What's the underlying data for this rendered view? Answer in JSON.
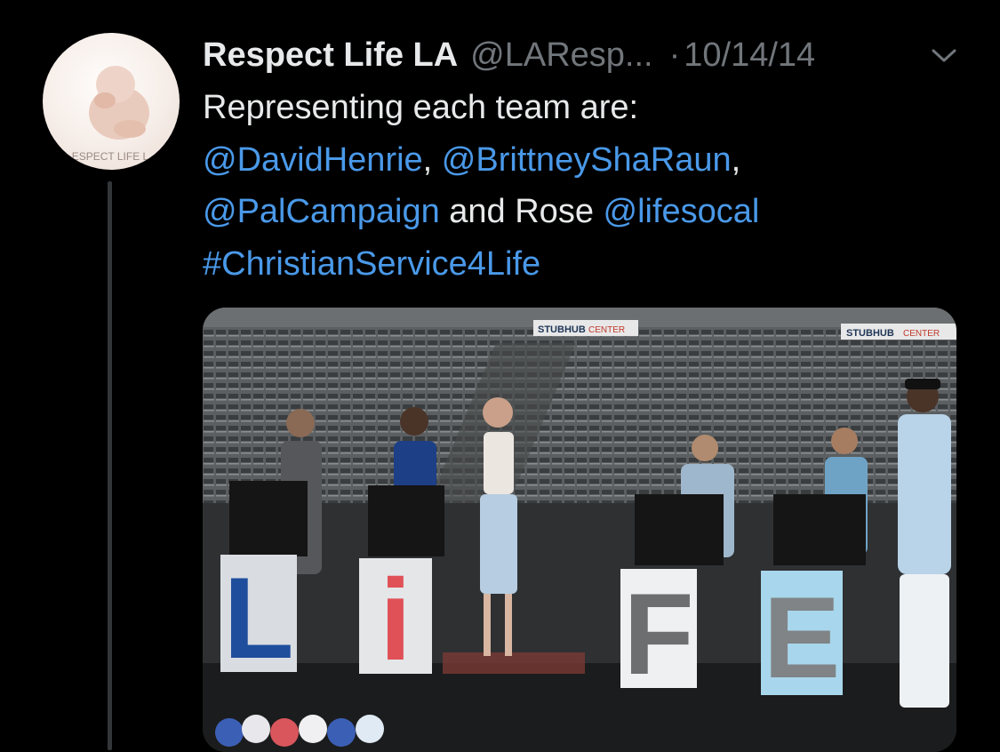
{
  "tweet": {
    "author_name": "Respect Life LA",
    "author_handle": "@LAResp...",
    "separator": "·",
    "date": "10/14/14",
    "avatar_text": "ESPECT LIFE L",
    "text_intro": "Representing each team are:",
    "mention_1": "@DavidHenrie",
    "comma_1": ",",
    "mention_2": "@BrittneyShaRaun",
    "comma_2": ",",
    "mention_3": "@PalCampaign",
    "text_and_rose": "and Rose",
    "mention_4": "@lifesocal",
    "hashtag": "#ChristianService4Life"
  },
  "photo": {
    "venue_sign_left": "STUBHUB",
    "venue_sign_left_2": "CENTER",
    "venue_sign_right": "STUBHUB",
    "venue_sign_right_2": "CENTER",
    "letter_1": "L",
    "letter_2": "i",
    "letter_3": "F",
    "letter_4": "E"
  },
  "colors": {
    "background": "#000000",
    "link": "#4a99e9",
    "muted": "#71767b",
    "text": "#e7e9ea"
  },
  "icons": [
    "caret-down-icon"
  ]
}
